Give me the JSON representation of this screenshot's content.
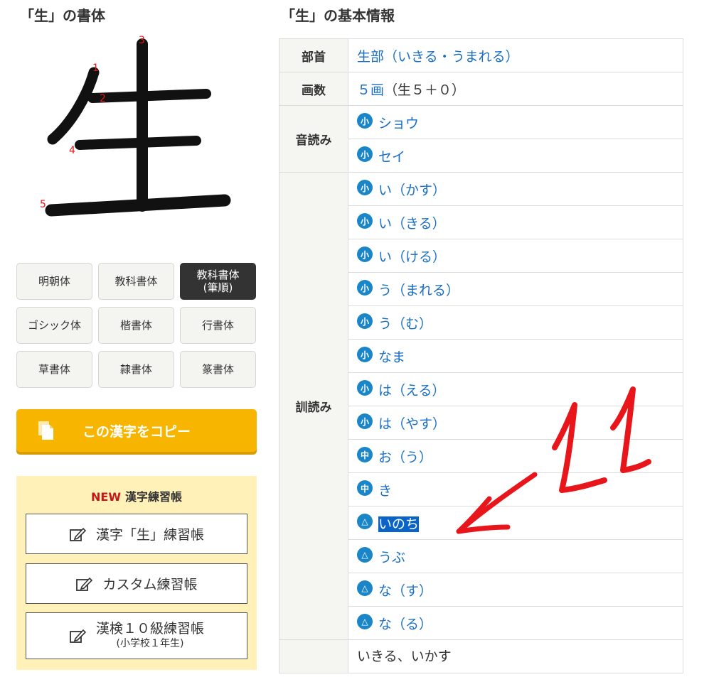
{
  "left_title": "「生」の書体",
  "right_title": "「生」の基本情報",
  "stroke_numbers": [
    "1",
    "2",
    "3",
    "4",
    "5"
  ],
  "font_styles": [
    {
      "label": "明朝体",
      "active": false
    },
    {
      "label": "教科書体",
      "active": false
    },
    {
      "label": "教科書体\n(筆順)",
      "active": true
    },
    {
      "label": "ゴシック体",
      "active": false
    },
    {
      "label": "楷書体",
      "active": false
    },
    {
      "label": "行書体",
      "active": false
    },
    {
      "label": "草書体",
      "active": false
    },
    {
      "label": "隷書体",
      "active": false
    },
    {
      "label": "篆書体",
      "active": false
    }
  ],
  "copy_button": "この漢字をコピー",
  "practice": {
    "new_label": "NEW",
    "title": "漢字練習帳",
    "items": [
      "漢字「生」練習帳",
      "カスタム練習帳"
    ],
    "kanken_label": "漢検１０級練習帳",
    "kanken_sub": "(小学校１年生)"
  },
  "info": {
    "bushu_header": "部首",
    "bushu_value": "生部（いきる・うまれる）",
    "kakusu_header": "画数",
    "kakusu_link": "５画",
    "kakusu_rest": "（生５＋０）",
    "on_header": "音読み",
    "on": [
      {
        "badge": "小",
        "text": "ショウ"
      },
      {
        "badge": "小",
        "text": "セイ"
      }
    ],
    "kun_header": "訓読み",
    "kun": [
      {
        "badge": "小",
        "text": "い（かす）"
      },
      {
        "badge": "小",
        "text": "い（きる）"
      },
      {
        "badge": "小",
        "text": "い（ける）"
      },
      {
        "badge": "小",
        "text": "う（まれる）"
      },
      {
        "badge": "小",
        "text": "う（む）"
      },
      {
        "badge": "小",
        "text": "なま"
      },
      {
        "badge": "小",
        "text": "は（える）"
      },
      {
        "badge": "小",
        "text": "は（やす）"
      },
      {
        "badge": "中",
        "text": "お（う）"
      },
      {
        "badge": "中",
        "text": "き"
      },
      {
        "badge": "△",
        "text": "いのち",
        "selected": true
      },
      {
        "badge": "△",
        "text": "うぶ"
      },
      {
        "badge": "△",
        "text": "な（す）"
      },
      {
        "badge": "△",
        "text": "な（る）"
      }
    ],
    "partial_row": "いきる、いかす"
  },
  "annotation_text": "11",
  "colors": {
    "accent": "#1a6fc4",
    "badge": "#1a86c8",
    "copy": "#f7b500",
    "annotation": "#e8151b",
    "practice_bg": "#fff1b8"
  }
}
